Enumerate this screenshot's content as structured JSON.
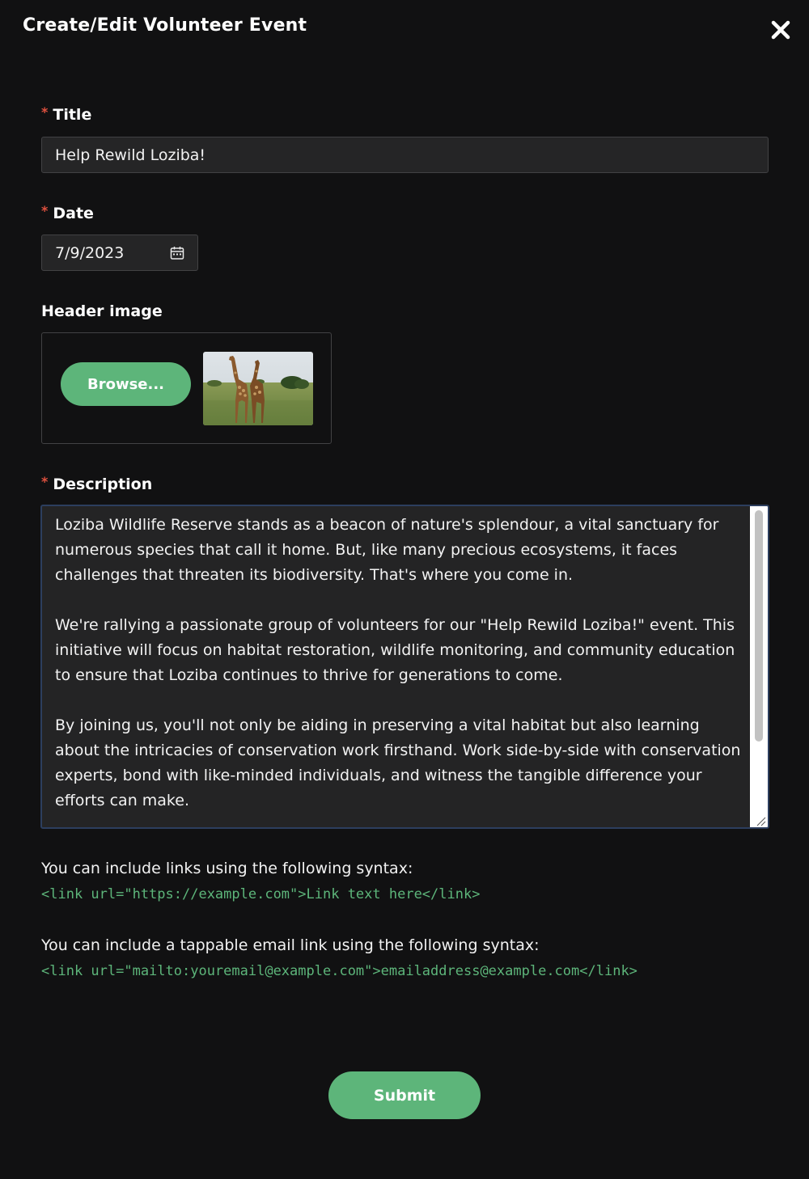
{
  "modal": {
    "title": "Create/Edit Volunteer Event",
    "close_icon": "close-icon"
  },
  "form": {
    "required_marker": "*",
    "title": {
      "label": "Title",
      "value": "Help Rewild Loziba!"
    },
    "date": {
      "label": "Date",
      "value": "7/9/2023",
      "icon": "calendar-icon"
    },
    "header_image": {
      "label": "Header image",
      "browse_label": "Browse...",
      "thumbnail": "giraffes-on-savanna-photo"
    },
    "description": {
      "label": "Description",
      "value": "Loziba Wildlife Reserve stands as a beacon of nature's splendour, a vital sanctuary for numerous species that call it home. But, like many precious ecosystems, it faces challenges that threaten its biodiversity. That's where you come in.\n\nWe're rallying a passionate group of volunteers for our \"Help Rewild Loziba!\" event. This initiative will focus on habitat restoration, wildlife monitoring, and community education to ensure that Loziba continues to thrive for generations to come.\n\nBy joining us, you'll not only be aiding in preserving a vital habitat but also learning about the intricacies of conservation work firsthand. Work side-by-side with conservation experts, bond with like-minded individuals, and witness the tangible difference your efforts can make."
    },
    "help": {
      "link_text": "You can include links using the following syntax:",
      "link_code": "<link url=\"https://example.com\">Link text here</link>",
      "email_text": "You can include a tappable email link using the following syntax:",
      "email_code": "<link url=\"mailto:youremail@example.com\">emailaddress@example.com</link>"
    },
    "submit_label": "Submit"
  },
  "colors": {
    "background": "#111112",
    "accent": "#5db57a",
    "required": "#e0513f",
    "input_bg": "#252526"
  }
}
